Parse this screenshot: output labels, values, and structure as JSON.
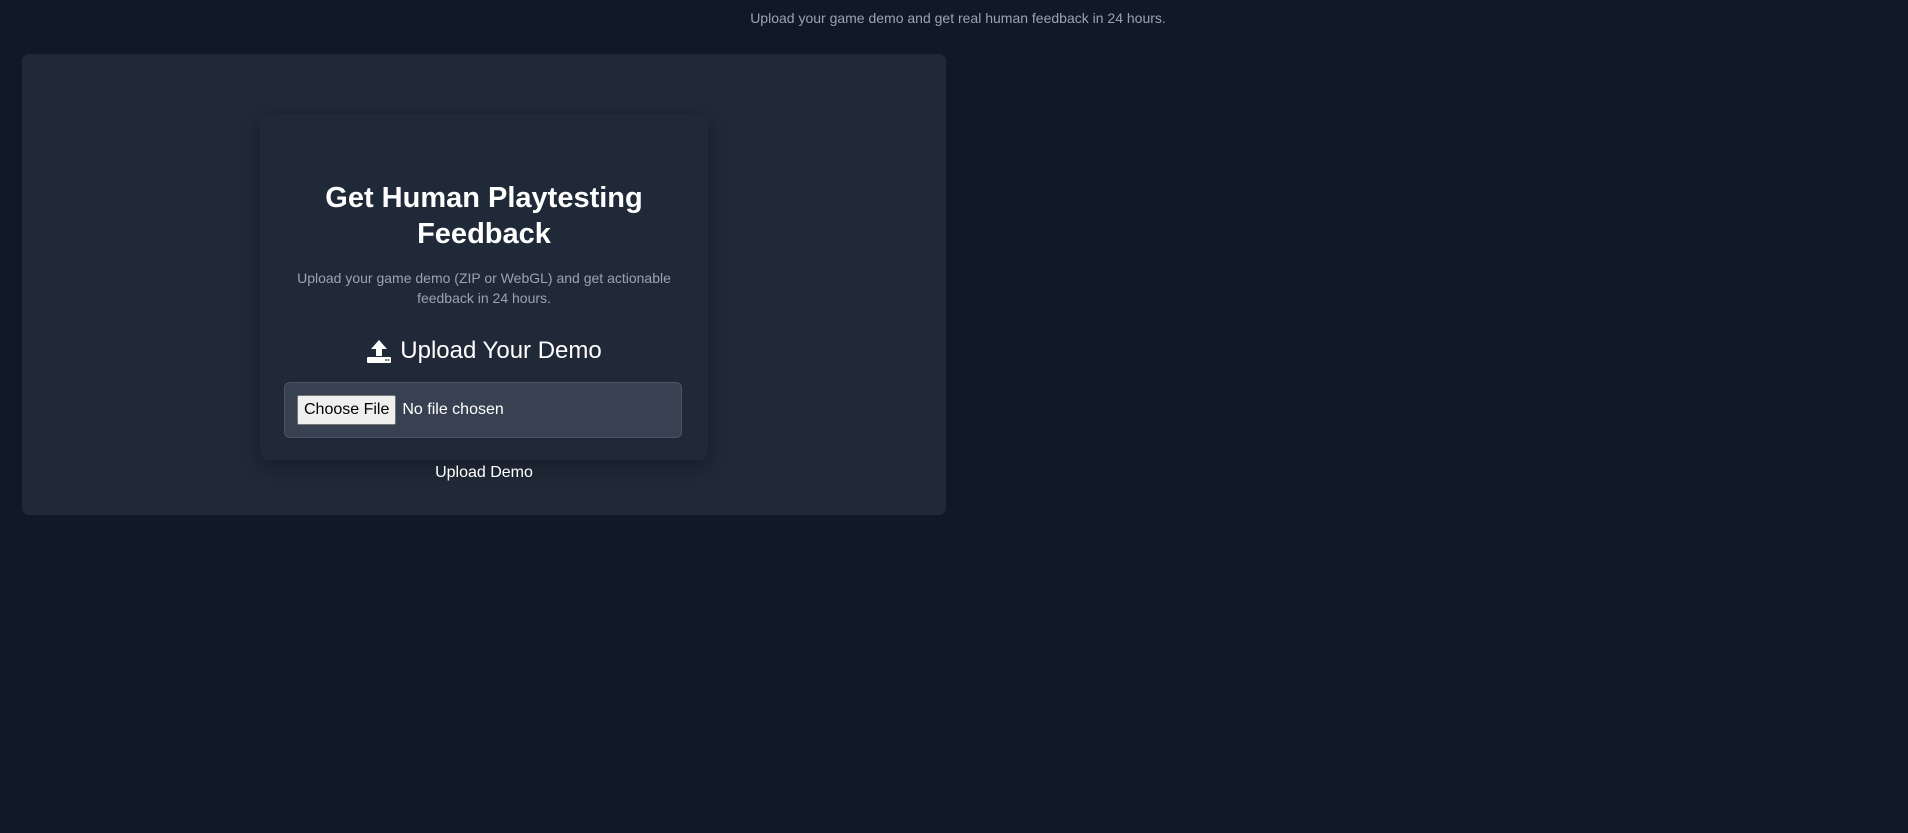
{
  "header": {
    "tagline": "Upload your game demo and get real human feedback in 24 hours."
  },
  "card": {
    "title": "Get Human Playtesting Feedback",
    "subtitle": "Upload your game demo (ZIP or WebGL) and get actionable feedback in 24 hours.",
    "section_heading": "Upload Your Demo",
    "section_icon": "upload-icon",
    "file_input": {
      "button_label": "Choose File",
      "status": "No file chosen"
    },
    "submit_label": "Upload Demo"
  },
  "colors": {
    "background": "#111827",
    "panel": "#1f2937",
    "input_bg": "#374151",
    "muted_text": "#9ca3af",
    "text": "#ffffff"
  }
}
